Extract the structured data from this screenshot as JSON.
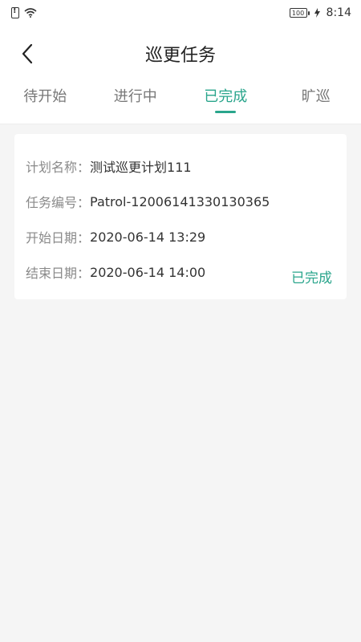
{
  "status_bar": {
    "time": "8:14",
    "battery_level": "100"
  },
  "header": {
    "title": "巡更任务"
  },
  "tabs": [
    {
      "label": "待开始",
      "active": false
    },
    {
      "label": "进行中",
      "active": false
    },
    {
      "label": "已完成",
      "active": true
    },
    {
      "label": "旷巡",
      "active": false
    }
  ],
  "task_card": {
    "plan_name_label": "计划名称：",
    "plan_name_value": "测试巡更计划111",
    "task_no_label": "任务编号：",
    "task_no_value": "Patrol-12006141330130365",
    "start_date_label": "开始日期：",
    "start_date_value": "2020-06-14 13:29",
    "end_date_label": "结束日期：",
    "end_date_value": "2020-06-14 14:00",
    "status": "已完成"
  },
  "colors": {
    "accent": "#2aa58c",
    "label_gray": "#8a8a8a",
    "text_dark": "#333333",
    "background": "#f5f5f5"
  }
}
